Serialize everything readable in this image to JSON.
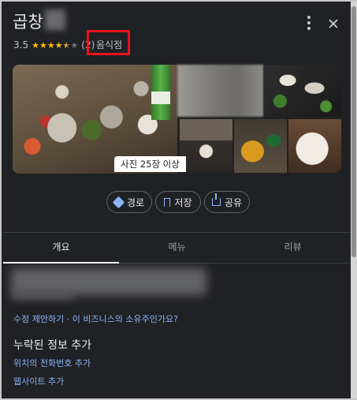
{
  "place": {
    "title_prefix": "곱창",
    "rating": "3.5",
    "stars_display": "★★★★",
    "star_half": "★",
    "star_empty": "★",
    "review_count": "(2)",
    "separator": "·",
    "category": "음식점"
  },
  "photos": {
    "count_label": "사진 25장 이상"
  },
  "actions": {
    "route_label": "경로",
    "save_label": "저장",
    "share_label": "공유"
  },
  "tabs": [
    {
      "label": "개요",
      "active": true
    },
    {
      "label": "메뉴",
      "active": false
    },
    {
      "label": "리뷰",
      "active": false
    }
  ],
  "info": {
    "suggest_edit": "수정 제안하기 · 이 비즈니스의 소유주인가요?",
    "missing_heading": "누락된 정보 추가",
    "add_phone": "위치의 전화번호 추가",
    "add_website": "웹사이트 추가"
  },
  "colors": {
    "background": "#202124",
    "highlight_box": "#e8141c",
    "link": "#8ab4f8",
    "star": "#fbbc04"
  },
  "icons": [
    "more-vert-icon",
    "close-icon",
    "directions-icon",
    "bookmark-icon",
    "share-icon"
  ]
}
